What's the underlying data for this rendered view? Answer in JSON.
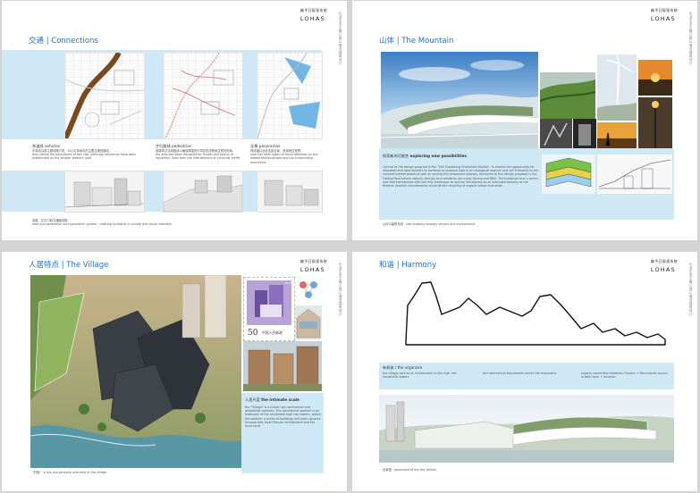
{
  "pages": [
    {
      "brand_cn": "编予日报观系统",
      "brand_en": "LOHAS",
      "side_text": "乐活生态主题公园&展览 建筑设计",
      "title": "交通 | Connections",
      "columns": [
        {
          "heading_cn": "车道线",
          "heading_en": "vehicles",
          "text_cn": "车道线沿着主题线路行进，可以见场地内的主要交通的路线。",
          "text_en": "they define the boundaries of this site, vehicular entrances have been established on the smaller western road"
        },
        {
          "heading_cn": "步行路线",
          "heading_en": "pedestrian",
          "text_cn": "道路穿过流线路线以确保周围的环境形成流畅而连贯的布局。",
          "text_en": "the area has been designed for fluidity and liberty of equalities, lines from the intersections of vehicular traffic"
        },
        {
          "heading_cn": "全景",
          "heading_en": "panoramas",
          "text_cn": "视线通过此处连接全景，呈现绝佳视野。",
          "text_en": "care has been taken to focus attention on the waterfront/landscape and the surrounding mountains"
        }
      ],
      "footer_cn": "道路 · 交叉口和交通路线图",
      "footer_en": "road and pedestrian and panoramic system · creating synthesis in private and visual interface"
    },
    {
      "brand_cn": "编予日报观系统",
      "brand_en": "LOHAS",
      "side_text": "乐活生态主题公园&展览 建筑设计",
      "title": "山体 | The Mountain",
      "panel_heading_cn": "探索新的可能性",
      "panel_heading_en": "exploring new possibilities",
      "panel_text": "Central to the design program is the \"Self Sustaining Production Market\". It creates the opportunity for relocated and local farmers to continue to produce food in an ecological manner and sell it directly to the covered market below as well as serving the restaurant industry. Anchored to this design proposal is the Fishing Pond where visitors, tourists and residents can enjoy fishing and BBQ. The buildings form a green roof that harmonises with the hilly landscape as well as functioning as an extended balcony to the theatre. Another consideration could be the recycling of organic waste and water.",
      "footer": "山体与建筑系统 · site enabling ecology service and environment"
    },
    {
      "brand_cn": "编予日报观系统",
      "brand_en": "LOHAS",
      "side_text": "乐活生态主题公园&展览 建筑设计",
      "title": "人居特点 | The Village",
      "stamp_value": "50",
      "stamp_label": "中国人民邮政",
      "stamp_corner": "2013",
      "panel_heading_cn": "人居尺度",
      "panel_heading_en": "the intimate scale",
      "panel_text": "the \"Village\" is a mixed use commercial and residential complex. The commercial podium is an extension of the residential high rise towers, above the podium, a series of buildings and open squares incorporates local Sichuan architecture and the local court",
      "footer": "\"村落\" · a live and personal overview of the Village"
    },
    {
      "brand_cn": "编予日报观系统",
      "brand_en": "LOHAS",
      "side_text": "乐活生态主题公园&展览 建筑设计",
      "title": "和谐 | Harmony",
      "cols": [
        {
          "head": "有机体 / the organism",
          "text": "the Village acts as an introduction to the high rise residential towers"
        },
        {
          "head": "",
          "text": "the commercial Monuments mimic the mountains"
        },
        {
          "head": "",
          "text": "organic connection between Theatre + Monuments occurs in both form + function"
        }
      ],
      "footer": "全景图 · panorama of the site section"
    }
  ]
}
